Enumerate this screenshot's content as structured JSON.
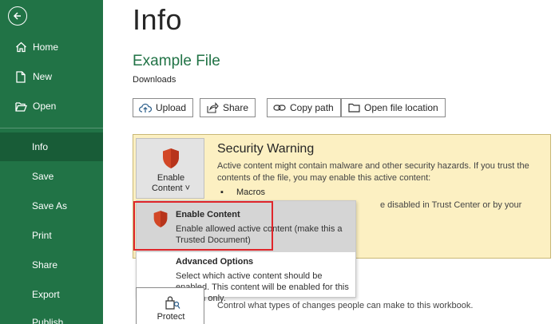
{
  "sidebar": {
    "items": [
      {
        "label": "Home",
        "icon": "home-icon"
      },
      {
        "label": "New",
        "icon": "new-file-icon"
      },
      {
        "label": "Open",
        "icon": "folder-open-icon"
      },
      {
        "label": "Info"
      },
      {
        "label": "Save"
      },
      {
        "label": "Save As"
      },
      {
        "label": "Print"
      },
      {
        "label": "Share"
      },
      {
        "label": "Export"
      },
      {
        "label": "Publish"
      }
    ],
    "active": "Info",
    "bg_color": "#217346",
    "active_color": "#185c37"
  },
  "page": {
    "title": "Info",
    "file_name": "Example File",
    "file_location": "Downloads"
  },
  "actions": [
    {
      "label": "Upload",
      "icon": "upload-icon"
    },
    {
      "label": "Share",
      "icon": "share-icon"
    },
    {
      "label": "Copy path",
      "icon": "link-icon"
    },
    {
      "label": "Open file location",
      "icon": "folder-icon"
    }
  ],
  "security": {
    "button_line1": "Enable",
    "button_line2": "Content ˅",
    "title": "Security Warning",
    "text": "Active content might contain malware and other security hazards. If you trust the contents of the file, you may enable this active content:",
    "bullet": "Macros",
    "text_more": "e disabled in Trust Center or by your",
    "bg_color": "#fcf0c2"
  },
  "dropdown": {
    "items": [
      {
        "title": "Enable Content",
        "desc": "Enable allowed active content (make this a Trusted Document)"
      },
      {
        "title": "Advanced Options",
        "desc": "Select which active content should be enabled. This content will be enabled for this session only."
      }
    ],
    "highlight_color": "#e0262b"
  },
  "protect": {
    "label": "Protect",
    "text": "Control what types of changes people can make to this workbook."
  }
}
